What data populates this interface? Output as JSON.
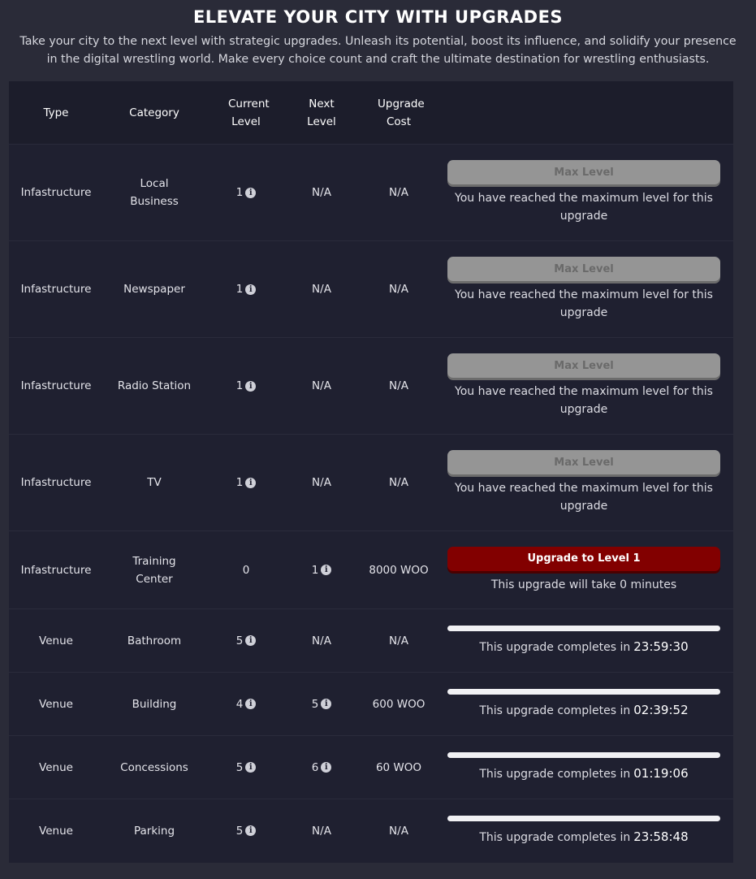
{
  "header": {
    "title": "ELEVATE YOUR CITY WITH UPGRADES",
    "subtitle": "Take your city to the next level with strategic upgrades. Unleash its potential, boost its influence, and solidify your presence in the digital wrestling world. Make every choice count and craft the ultimate destination for wrestling enthusiasts."
  },
  "table": {
    "headers": {
      "type": "Type",
      "category": "Category",
      "current_level": "Current Level",
      "next_level": "Next Level",
      "upgrade_cost": "Upgrade Cost"
    },
    "rows": [
      {
        "type": "Infastructure",
        "category": "Local Business",
        "current": "1",
        "next": "N/A",
        "cost": "N/A",
        "button": "Max Level",
        "note": "You have reached the maximum level for this upgrade"
      },
      {
        "type": "Infastructure",
        "category": "Newspaper",
        "current": "1",
        "next": "N/A",
        "cost": "N/A",
        "button": "Max Level",
        "note": "You have reached the maximum level for this upgrade"
      },
      {
        "type": "Infastructure",
        "category": "Radio Station",
        "current": "1",
        "next": "N/A",
        "cost": "N/A",
        "button": "Max Level",
        "note": "You have reached the maximum level for this upgrade"
      },
      {
        "type": "Infastructure",
        "category": "TV",
        "current": "1",
        "next": "N/A",
        "cost": "N/A",
        "button": "Max Level",
        "note": "You have reached the maximum level for this upgrade"
      },
      {
        "type": "Infastructure",
        "category": "Training Center",
        "current": "0",
        "next": "1",
        "cost": "8000 WOO",
        "button": "Upgrade to Level 1",
        "note": "This upgrade will take 0 minutes"
      },
      {
        "type": "Venue",
        "category": "Bathroom",
        "current": "5",
        "next": "N/A",
        "cost": "N/A",
        "label": "This upgrade completes in",
        "timer": "23:59:30"
      },
      {
        "type": "Venue",
        "category": "Building",
        "current": "4",
        "next": "5",
        "cost": "600 WOO",
        "label": "This upgrade completes in",
        "timer": "02:39:52"
      },
      {
        "type": "Venue",
        "category": "Concessions",
        "current": "5",
        "next": "6",
        "cost": "60 WOO",
        "label": "This upgrade completes in",
        "timer": "01:19:06"
      },
      {
        "type": "Venue",
        "category": "Parking",
        "current": "5",
        "next": "N/A",
        "cost": "N/A",
        "label": "This upgrade completes in",
        "timer": "23:58:48"
      }
    ]
  },
  "icons": {
    "info": "info-circle-icon"
  },
  "colors": {
    "upgrade_button": "#820000",
    "max_button": "#959595",
    "background": "#2a2b38"
  }
}
